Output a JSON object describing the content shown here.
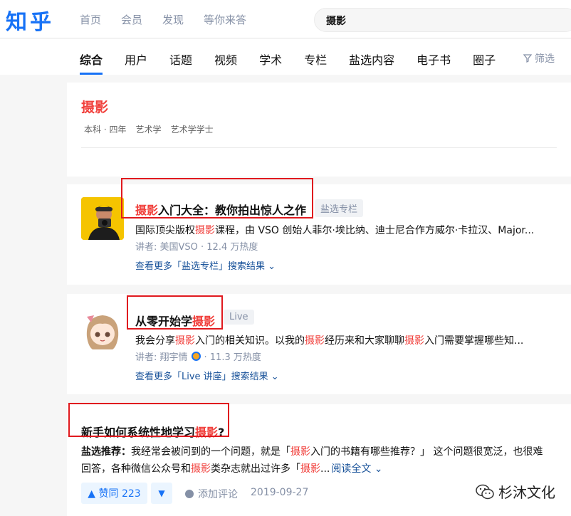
{
  "header": {
    "logo": "知乎",
    "nav": [
      "首页",
      "会员",
      "发现",
      "等你来答"
    ],
    "search_value": "摄影"
  },
  "tabs": [
    "综合",
    "用户",
    "话题",
    "视频",
    "学术",
    "专栏",
    "盐选内容",
    "电子书",
    "圈子"
  ],
  "filter_label": "筛选",
  "major_card": {
    "title": "摄影",
    "tags": [
      "本科 · 四年",
      "艺术学",
      "艺术学学士"
    ]
  },
  "column_card": {
    "title_hl": "摄影",
    "title_rest": "入门大全：教你拍出惊人之作",
    "badge": "盐选专栏",
    "desc_pre": "国际顶尖版权",
    "desc_hl": "摄影",
    "desc_post": "课程，由 VSO 创始人菲尔·埃比纳、迪士尼合作方威尔·卡拉汉、Major...",
    "meta": "讲者: 美国VSO · 12.4 万热度",
    "more": "查看更多「盐选专栏」搜索结果 ⌄"
  },
  "live_card": {
    "title_pre": "从零开始学",
    "title_hl": "摄影",
    "badge": "Live",
    "desc_1": "我会分享",
    "desc_hl1": "摄影",
    "desc_2": "入门的相关知识。以我的",
    "desc_hl2": "摄影",
    "desc_3": "经历来和大家聊聊",
    "desc_hl3": "摄影",
    "desc_4": "入门需要掌握哪些知...",
    "meta_pre": "讲者: 翔宇情",
    "meta_post": "· 11.3 万热度",
    "more": "查看更多「Live 讲座」搜索结果 ⌄"
  },
  "question_card": {
    "title_pre": "新手如何系统性地学习",
    "title_hl": "摄影",
    "title_post": "?",
    "line1_label": "盐选推荐：",
    "line1_a": "我经常会被问到的一个问题，就是「",
    "line1_hl": "摄影",
    "line1_b": "入门的书籍有哪些推荐？」 这个问题很宽泛，也很难",
    "line2_a": "回答，各种微信公众号和",
    "line2_hl": "摄影",
    "line2_b": "类杂志就出过许多「",
    "line2_hl2": "摄影",
    "line2_c": "...",
    "read_more": "阅读全文 ⌄",
    "upvote": "▲ 赞同 223",
    "downvote": "▼",
    "comment": "添加评论",
    "date": "2019-09-27"
  },
  "watermark": "杉沐文化",
  "colors": {
    "accent": "#1772f6",
    "highlight": "#f1403c",
    "annotation_box": "#e0191e"
  }
}
